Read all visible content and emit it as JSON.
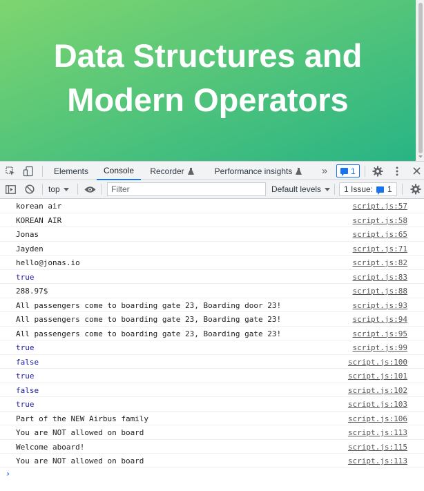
{
  "hero": {
    "title": "Data Structures and Modern Operators",
    "gradient_from": "#7ed56f",
    "gradient_to": "#28b485"
  },
  "devtools": {
    "tabs": [
      {
        "label": "Elements",
        "active": false
      },
      {
        "label": "Console",
        "active": true
      },
      {
        "label": "Recorder",
        "active": false,
        "icon": "flask-icon"
      },
      {
        "label": "Performance insights",
        "active": false,
        "icon": "flask-icon"
      }
    ],
    "more_tabs_glyph": "»",
    "messages_badge": "1",
    "icons": {
      "inspect": "inspect-element-icon",
      "device": "device-toolbar-icon",
      "settings": "gear-icon",
      "menu": "kebab-menu-icon",
      "close": "close-icon"
    }
  },
  "toolbar": {
    "context": "top",
    "filter_placeholder": "Filter",
    "levels": "Default levels",
    "issues_label": "1 Issue:",
    "issues_count": "1",
    "icons": {
      "sidebar": "console-sidebar-icon",
      "clear": "clear-console-icon",
      "eye": "live-expression-eye-icon",
      "settings": "gear-icon"
    }
  },
  "console": {
    "rows": [
      {
        "text": "korean air",
        "source": "script.js:57",
        "bool": false
      },
      {
        "text": "KOREAN AIR",
        "source": "script.js:58",
        "bool": false
      },
      {
        "text": "Jonas",
        "source": "script.js:65",
        "bool": false
      },
      {
        "text": "Jayden",
        "source": "script.js:71",
        "bool": false
      },
      {
        "text": "hello@jonas.io",
        "source": "script.js:82",
        "bool": false
      },
      {
        "text": "true",
        "source": "script.js:83",
        "bool": true
      },
      {
        "text": "288.97$",
        "source": "script.js:88",
        "bool": false
      },
      {
        "text": "All passengers come to boarding gate 23, Boarding door 23!",
        "source": "script.js:93",
        "bool": false
      },
      {
        "text": "All passengers come to boarding gate 23, Boarding gate 23!",
        "source": "script.js:94",
        "bool": false
      },
      {
        "text": "All passengers come to boarding gate 23, Boarding gate 23!",
        "source": "script.js:95",
        "bool": false
      },
      {
        "text": "true",
        "source": "script.js:99",
        "bool": true
      },
      {
        "text": "false",
        "source": "script.js:100",
        "bool": true
      },
      {
        "text": "true",
        "source": "script.js:101",
        "bool": true
      },
      {
        "text": "false",
        "source": "script.js:102",
        "bool": true
      },
      {
        "text": "true",
        "source": "script.js:103",
        "bool": true
      },
      {
        "text": "Part of the NEW Airbus family",
        "source": "script.js:106",
        "bool": false
      },
      {
        "text": "You are NOT allowed on board",
        "source": "script.js:113",
        "bool": false
      },
      {
        "text": "Welcome aboard!",
        "source": "script.js:115",
        "bool": false
      },
      {
        "text": "You are NOT allowed on board",
        "source": "script.js:113",
        "bool": false
      }
    ],
    "prompt_glyph": "›"
  }
}
